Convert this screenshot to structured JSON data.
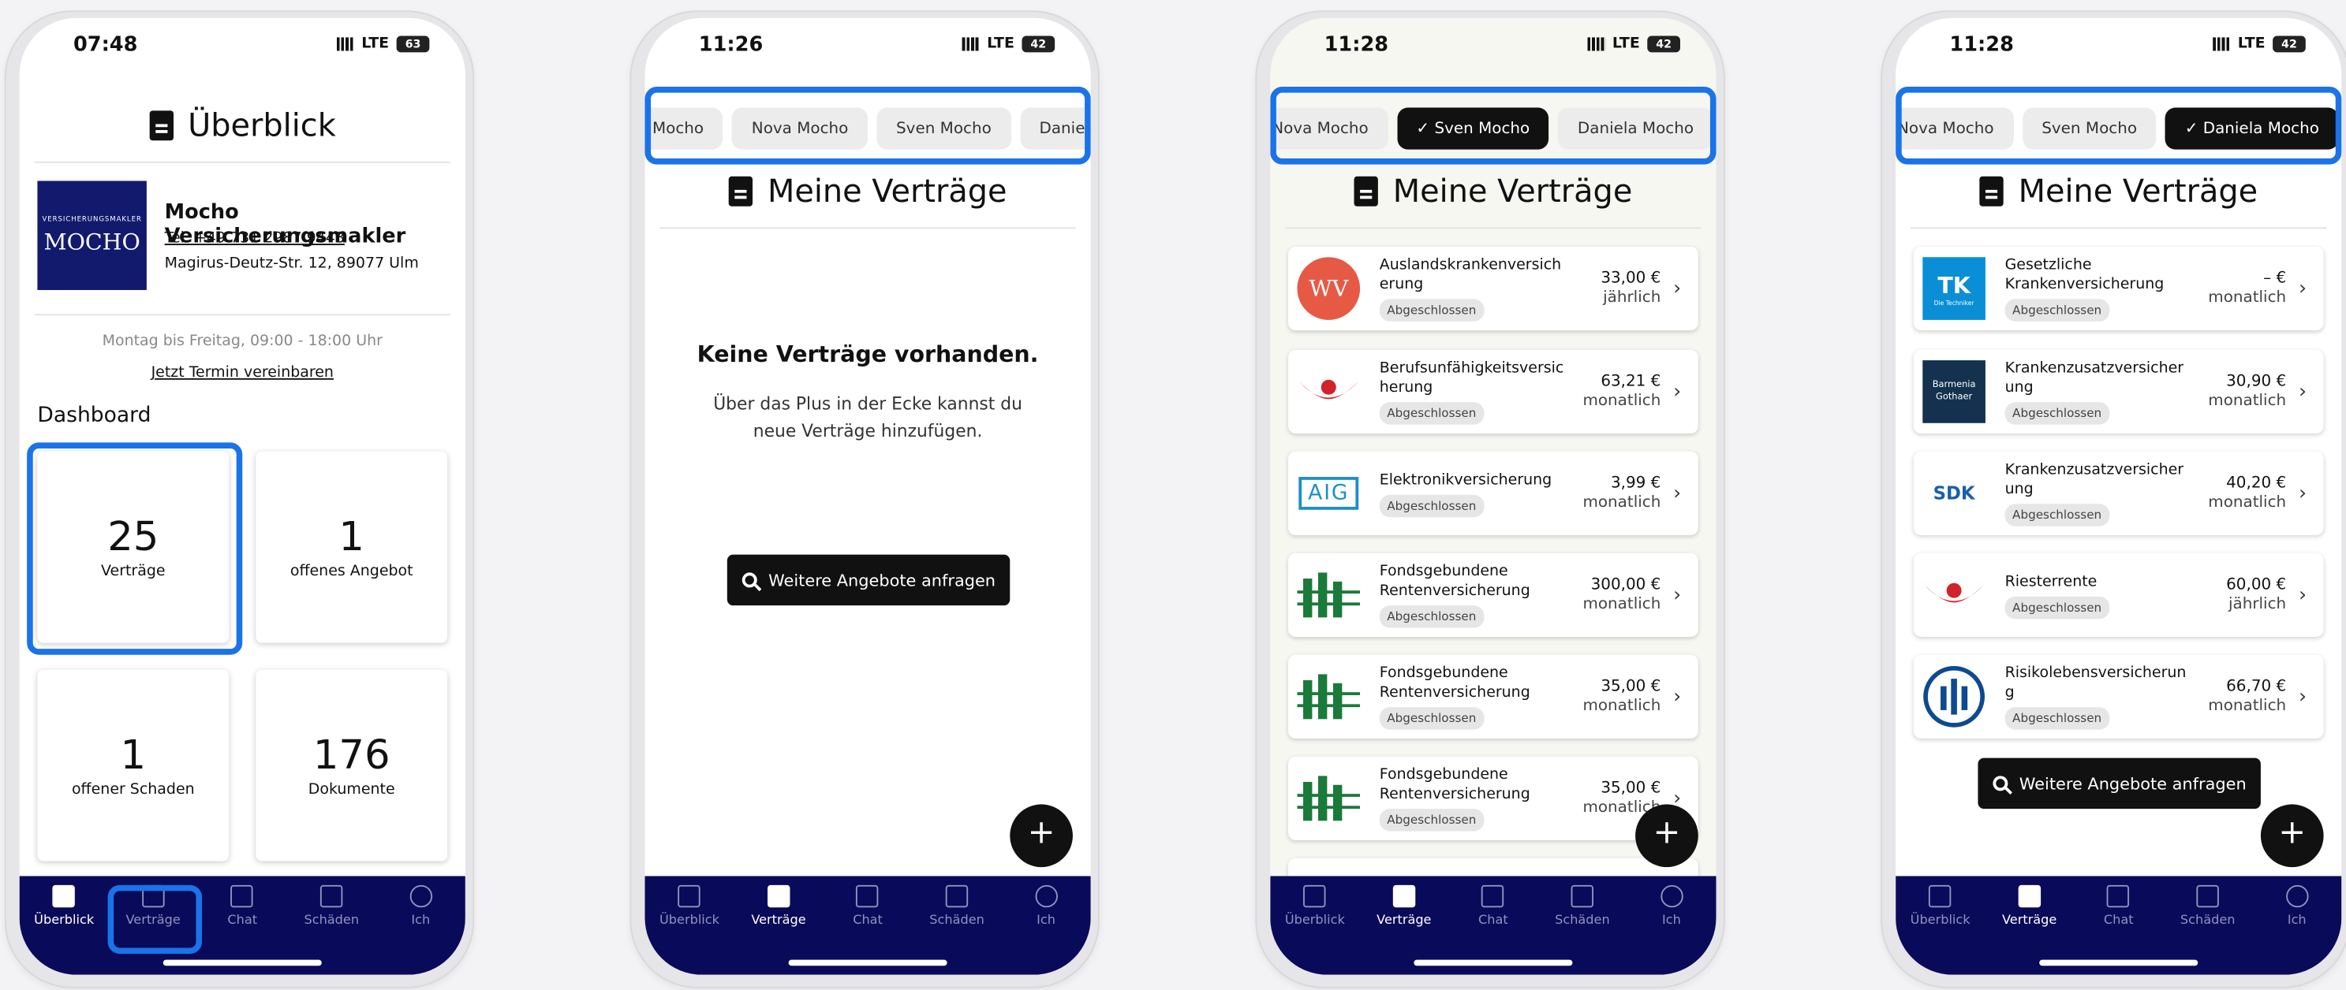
{
  "tabs": [
    {
      "label": "Überblick",
      "icon": "document-person-icon"
    },
    {
      "label": "Verträge",
      "icon": "document-icon"
    },
    {
      "label": "Chat",
      "icon": "chat-icon"
    },
    {
      "label": "Schäden",
      "icon": "chart-icon"
    },
    {
      "label": "Ich",
      "icon": "person-icon"
    }
  ],
  "p1": {
    "time": "07:48",
    "network": "LTE",
    "battery": "63",
    "title": "Überblick",
    "broker": {
      "logo_small": "VERSICHERUNGSMAKLER",
      "logo_big": "MOCHO",
      "name": "Mocho Versicherungsmakler",
      "phone": "Tel. +49 731 2987 9448",
      "address": "Magirus-Deutz-Str. 12, 89077 Ulm"
    },
    "hours": "Montag bis Freitag, 09:00 - 18:00 Uhr",
    "appointment": "Jetzt Termin vereinbaren",
    "dashboard": "Dashboard",
    "tiles": [
      {
        "n": "25",
        "l": "Verträge"
      },
      {
        "n": "1",
        "l": "offenes Angebot"
      },
      {
        "n": "1",
        "l": "offener Schaden"
      },
      {
        "n": "176",
        "l": "Dokumente"
      }
    ]
  },
  "p2": {
    "time": "11:26",
    "network": "LTE",
    "battery": "42",
    "chips": [
      "Mocho",
      "Nova Mocho",
      "Sven Mocho",
      "Daniela M"
    ],
    "title": "Meine Verträge",
    "empty_title": "Keine Verträge vorhanden.",
    "empty_text": "Über das Plus in der Ecke kannst du neue Verträge hinzufügen.",
    "cta": "Weitere Angebote anfragen",
    "fab": "+"
  },
  "p3": {
    "time": "11:28",
    "network": "LTE",
    "battery": "42",
    "chips": [
      "Nova Mocho",
      "Sven Mocho",
      "Daniela Mocho"
    ],
    "title": "Meine Verträge",
    "fab": "+",
    "contracts": [
      {
        "name": "Auslandskrankenversicherung",
        "status": "Abgeschlossen",
        "price": "33,00 €",
        "period": "jährlich",
        "logo": "WV"
      },
      {
        "name": "Berufsunfähigkeitsversicherung",
        "status": "Abgeschlossen",
        "price": "63,21 €",
        "period": "monatlich",
        "logo": ""
      },
      {
        "name": "Elektronikversicherung",
        "status": "Abgeschlossen",
        "price": "3,99 €",
        "period": "monatlich",
        "logo": "AIG"
      },
      {
        "name": "Fondsgebundene Rentenversicherung",
        "status": "Abgeschlossen",
        "price": "300,00 €",
        "period": "monatlich",
        "logo": ""
      },
      {
        "name": "Fondsgebundene Rentenversicherung",
        "status": "Abgeschlossen",
        "price": "35,00 €",
        "period": "monatlich",
        "logo": ""
      },
      {
        "name": "Fondsgebundene Rentenversicherung",
        "status": "Abgeschlossen",
        "price": "35,00 €",
        "period": "monatlich",
        "logo": ""
      }
    ]
  },
  "p4": {
    "time": "11:28",
    "network": "LTE",
    "battery": "42",
    "chips": [
      "Nova Mocho",
      "Sven Mocho",
      "Daniela Mocho"
    ],
    "title": "Meine Verträge",
    "cta": "Weitere Angebote anfragen",
    "fab": "+",
    "contracts": [
      {
        "name": "Gesetzliche Krankenversicherung",
        "status": "Abgeschlossen",
        "price": "– €",
        "period": "monatlich",
        "logo": "TK",
        "logo_sub": "Die Techniker"
      },
      {
        "name": "Krankenzusatzversicherung",
        "status": "Abgeschlossen",
        "price": "30,90 €",
        "period": "monatlich",
        "logo": "Barmenia Gothaer"
      },
      {
        "name": "Krankenzusatzversicherung",
        "status": "Abgeschlossen",
        "price": "40,20 €",
        "period": "monatlich",
        "logo": "SDK"
      },
      {
        "name": "Riesterrente",
        "status": "Abgeschlossen",
        "price": "60,00 €",
        "period": "jährlich",
        "logo": ""
      },
      {
        "name": "Risikolebensversicherung",
        "status": "Abgeschlossen",
        "price": "66,70 €",
        "period": "monatlich",
        "logo": ""
      }
    ]
  }
}
